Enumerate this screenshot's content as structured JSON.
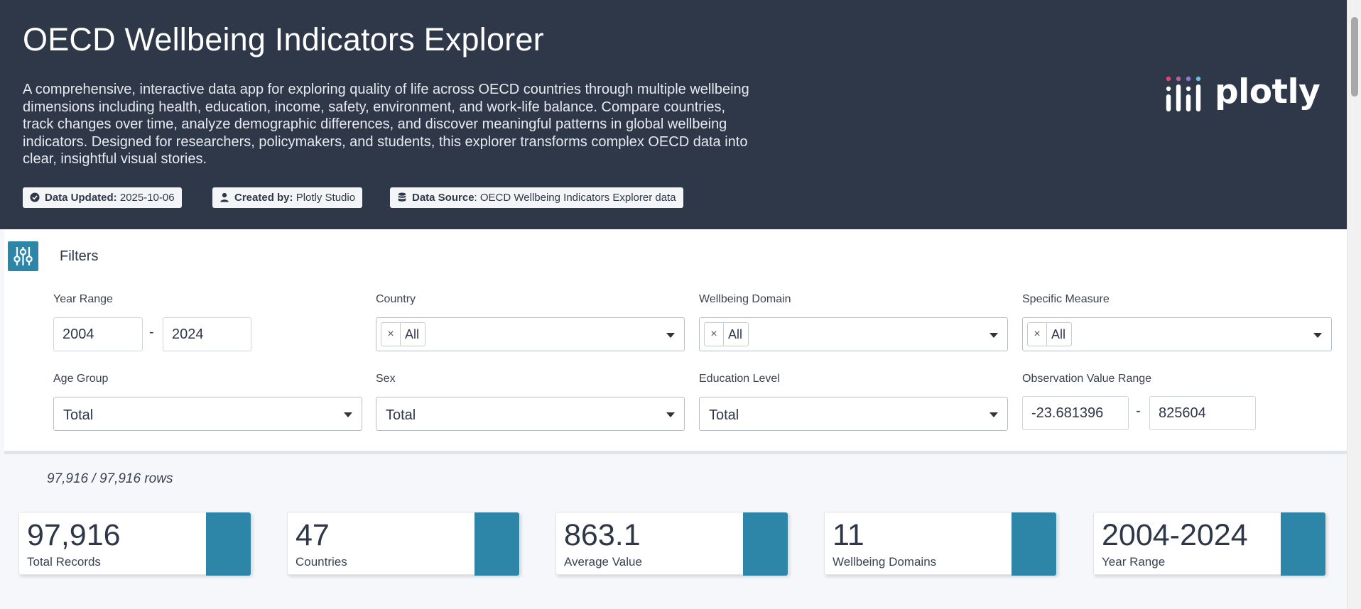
{
  "header": {
    "title": "OECD Wellbeing Indicators Explorer",
    "description": "A comprehensive, interactive data app for exploring quality of life across OECD countries through multiple wellbeing dimensions including health, education, income, safety, environment, and work-life balance. Compare countries, track changes over time, analyze demographic differences, and discover meaningful patterns in global wellbeing indicators. Designed for researchers, policymakers, and students, this explorer transforms complex OECD data into clear, insightful visual stories.",
    "badges": [
      {
        "label": "Data Updated:",
        "value": " 2025-10-06",
        "icon": "check-circle-icon"
      },
      {
        "label": "Created by:",
        "value": " Plotly Studio",
        "icon": "user-icon"
      },
      {
        "label": "Data Source",
        "value": ": OECD Wellbeing Indicators Explorer data",
        "icon": "database-icon"
      }
    ],
    "logo_text": "plotly"
  },
  "filters": {
    "title": "Filters",
    "year_range": {
      "label": "Year Range",
      "from": "2004",
      "to": "2024",
      "separator": "-"
    },
    "country": {
      "label": "Country",
      "chip": "All"
    },
    "wellbeing_domain": {
      "label": "Wellbeing Domain",
      "chip": "All"
    },
    "specific_measure": {
      "label": "Specific Measure",
      "chip": "All"
    },
    "age_group": {
      "label": "Age Group",
      "value": "Total"
    },
    "sex": {
      "label": "Sex",
      "value": "Total"
    },
    "education_level": {
      "label": "Education Level",
      "value": "Total"
    },
    "observation_range": {
      "label": "Observation Value Range",
      "from": "-23.681396",
      "to": "825604",
      "separator": "-"
    }
  },
  "rows_count": "97,916 / 97,916 rows",
  "cards": [
    {
      "value": "97,916",
      "label": "Total Records"
    },
    {
      "value": "47",
      "label": "Countries"
    },
    {
      "value": "863.1",
      "label": "Average Value"
    },
    {
      "value": "11",
      "label": "Wellbeing Domains"
    },
    {
      "value": "2004-2024",
      "label": "Year Range"
    }
  ],
  "colors": {
    "header_bg": "#2f3849",
    "accent": "#2d85a8",
    "page_bg": "#f5f7fa"
  }
}
